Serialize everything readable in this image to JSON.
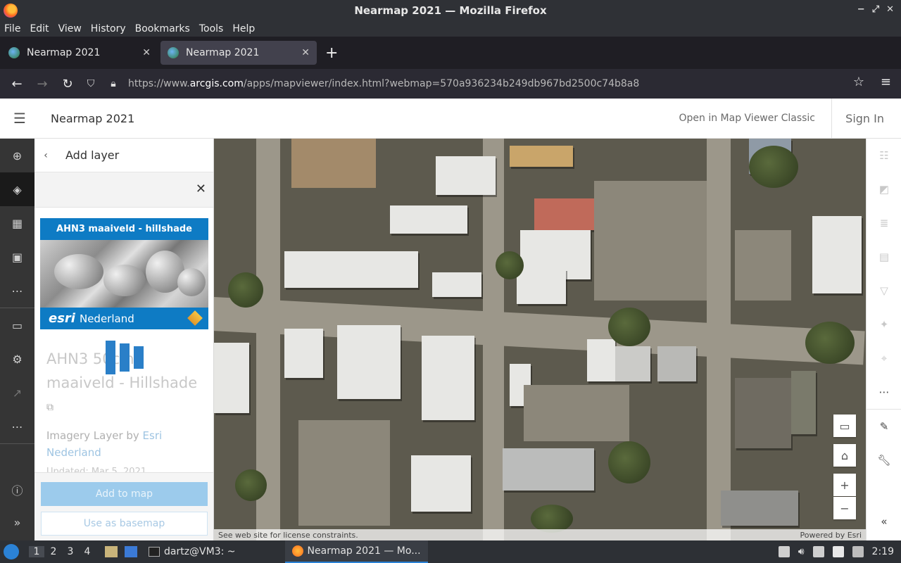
{
  "window": {
    "title": "Nearmap 2021 — Mozilla Firefox"
  },
  "menubar": {
    "items": [
      "File",
      "Edit",
      "View",
      "History",
      "Bookmarks",
      "Tools",
      "Help"
    ]
  },
  "tabs": [
    {
      "label": "Nearmap 2021",
      "active": false
    },
    {
      "label": "Nearmap 2021",
      "active": true
    }
  ],
  "url": {
    "prefix": "https://www.",
    "host": "arcgis.com",
    "path": "/apps/mapviewer/index.html?webmap=570a936234b249db967bd2500c74b8a8"
  },
  "app": {
    "title": "Nearmap 2021",
    "classic_link": "Open in Map Viewer Classic",
    "sign_in": "Sign In"
  },
  "panel": {
    "title": "Add layer",
    "thumbnail": {
      "top_text": "AHN3 maaiveld - hillshade",
      "bottom_brand": "esri",
      "bottom_text": "Nederland"
    },
    "layer_name": "AHN3 50cm maaiveld - Hillshade",
    "layer_type": "Imagery Layer by ",
    "owner_link": "Esri Nederland",
    "updated": "Updated: Mar 5, 2021",
    "add_button": "Add to map",
    "basemap_button": "Use as basemap"
  },
  "map": {
    "attribution_left": "See web site for license constraints.",
    "attribution_right": "Powered by Esri"
  },
  "taskbar": {
    "workspaces": [
      "1",
      "2",
      "3",
      "4"
    ],
    "terminal": "dartz@VM3: ~",
    "browser_task": "Nearmap 2021 — Mo...",
    "clock": "2:19"
  },
  "colors": {
    "accent": "#0e7bc4",
    "add_button": "#9ccbec",
    "dark_toolbar": "#353535"
  }
}
